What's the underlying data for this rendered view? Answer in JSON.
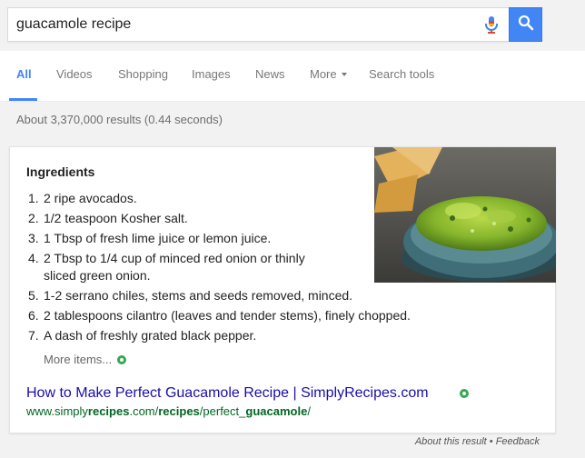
{
  "search": {
    "query": "guacamole recipe",
    "mic_icon": "microphone-icon",
    "search_icon": "magnifier-icon",
    "accent": "#4285f4"
  },
  "tabs": [
    {
      "label": "All",
      "active": true
    },
    {
      "label": "Videos"
    },
    {
      "label": "Shopping"
    },
    {
      "label": "Images"
    },
    {
      "label": "News"
    },
    {
      "label": "More"
    },
    {
      "label": "Search tools"
    }
  ],
  "result_stats": "About 3,370,000 results (0.44 seconds)",
  "snippet": {
    "heading": "Ingredients",
    "items": [
      {
        "num": "1.",
        "text": "2 ripe avocados."
      },
      {
        "num": "2.",
        "text": "1/2 teaspoon Kosher salt."
      },
      {
        "num": "3.",
        "text": "1 Tbsp of fresh lime juice or lemon juice."
      },
      {
        "num": "4.",
        "text": "2 Tbsp to 1/4 cup of minced red onion or thinly",
        "text2": "sliced green onion."
      },
      {
        "num": "5.",
        "text": "1-2 serrano chiles, stems and seeds removed, minced."
      },
      {
        "num": "6.",
        "text": "2 tablespoons cilantro (leaves and tender stems), finely chopped."
      },
      {
        "num": "7.",
        "text": "A dash of freshly grated black pepper."
      }
    ],
    "more_items": "More items...",
    "link_title": "How to Make Perfect Guacamole Recipe | SimplyRecipes.com",
    "url_parts": [
      "www.simply",
      "recipes",
      ".com/",
      "recipes",
      "/perfect_",
      "guacamole",
      "/"
    ],
    "link_color": "#1a0dab",
    "url_color": "#006621"
  },
  "footer": {
    "about": "About this result",
    "separator": " • ",
    "feedback": "Feedback"
  }
}
